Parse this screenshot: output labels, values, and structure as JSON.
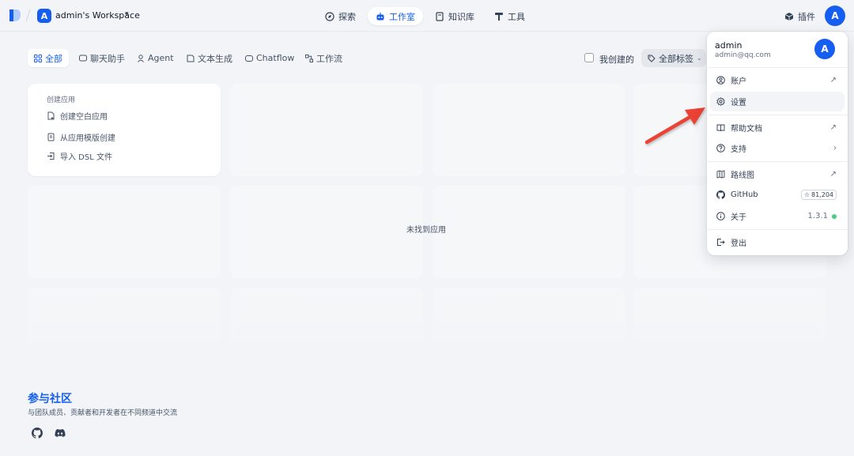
{
  "colors": {
    "accent": "#155eef",
    "arrow": "#ea4335",
    "status": "#47cd89"
  },
  "header": {
    "workspace_badge": "A",
    "workspace_name": "admin's Workspace",
    "nav": [
      {
        "label": "探索",
        "icon": "compass-icon"
      },
      {
        "label": "工作室",
        "icon": "robot-icon"
      },
      {
        "label": "知识库",
        "icon": "book-icon"
      },
      {
        "label": "工具",
        "icon": "hammer-icon"
      }
    ],
    "plugins_label": "插件",
    "avatar": "A"
  },
  "filters": {
    "tabs": [
      "全部",
      "聊天助手",
      "Agent",
      "文本生成",
      "Chatflow",
      "工作流"
    ],
    "mine_label": "我创建的",
    "tags_label": "全部标签"
  },
  "create": {
    "title": "创建应用",
    "items": [
      "创建空白应用",
      "从应用模版创建",
      "导入 DSL 文件"
    ]
  },
  "empty_text": "未找到应用",
  "community": {
    "title": "参与社区",
    "subtitle": "与团队成员、贡献者和开发者在不同频道中交流"
  },
  "menu": {
    "name": "admin",
    "email": "admin@qq.com",
    "avatar": "A",
    "items": {
      "account": "账户",
      "settings": "设置",
      "help": "帮助文档",
      "support": "支持",
      "roadmap": "路线图",
      "github": "GitHub",
      "github_stars": "81,204",
      "about": "关于",
      "version": "1.3.1",
      "logout": "登出"
    }
  }
}
